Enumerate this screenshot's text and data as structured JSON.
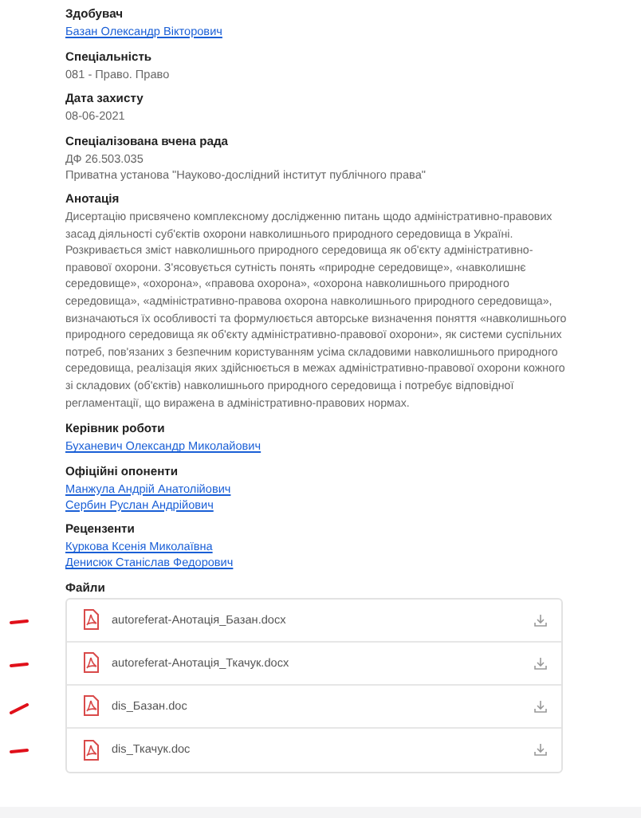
{
  "sections": [
    {
      "kind": "text",
      "label": "Здобувач",
      "values": [
        {
          "text": "Базан Олександр Вікторович",
          "link": true
        }
      ]
    },
    {
      "kind": "text",
      "label": "Спеціальність",
      "values": [
        {
          "text": "081 - Право. Право",
          "link": false
        }
      ]
    },
    {
      "kind": "text",
      "label": "Дата захисту",
      "values": [
        {
          "text": "08-06-2021",
          "link": false
        }
      ]
    },
    {
      "kind": "text",
      "label": "Спеціалізована вчена рада",
      "values": [
        {
          "text": "ДФ 26.503.035",
          "link": false
        },
        {
          "text": "Приватна установа \"Науково-дослідний інститут публічного права\"",
          "link": false
        }
      ]
    },
    {
      "kind": "paragraph",
      "label": "Анотація",
      "values": [
        {
          "text": "Дисертацію присвячено комплексному дослідженню питань щодо адміністративно-правових засад діяльності суб'єктів охорони навколишнього природного середовища в Україні. Розкривається зміст навколишнього природного середовища як об'єкту адміністративно-правової охорони. З'ясовується сутність понять «природне середовище», «навколишнє середовище», «охорона», «правова охорона», «охорона навколишнього природного середовища», «адміністративно-правова охорона навколишнього природного середовища», визначаються їх особливості та формулюється авторське визначення поняття «навколишнього природного середовища як об'єкту адміністративно-правової охорони», як системи суспільних потреб, пов'язаних з безпечним користуванням усіма складовими навколишнього природного середовища, реалізація яких здійснюється в межах адміністративно-правової охорони кожного зі складових (об'єктів) навколишнього природного середовища і потребує відповідної регламентації, що виражена в адміністративно-правових нормах."
        }
      ]
    },
    {
      "kind": "text",
      "label": "Керівник роботи",
      "values": [
        {
          "text": "Буханевич Олександр Миколайович",
          "link": true
        }
      ]
    },
    {
      "kind": "text",
      "label": "Офіційні опоненти",
      "values": [
        {
          "text": "Манжула Андрій Анатолійович",
          "link": true
        },
        {
          "text": "Сербин Руслан Андрійович",
          "link": true
        }
      ]
    },
    {
      "kind": "text",
      "label": "Рецензенти",
      "values": [
        {
          "text": "Куркова Ксенія Миколаївна",
          "link": true
        },
        {
          "text": "Денисюк Станіслав Федорович",
          "link": true
        }
      ]
    }
  ],
  "files": {
    "label": "Файли",
    "items": [
      {
        "name": "autoreferat-Анотація_Базан.docx",
        "marked": true
      },
      {
        "name": "autoreferat-Анотація_Ткачук.docx",
        "marked": true
      },
      {
        "name": "dis_Базан.doc",
        "marked": true
      },
      {
        "name": "dis_Ткачук.doc",
        "marked": true
      }
    ]
  }
}
